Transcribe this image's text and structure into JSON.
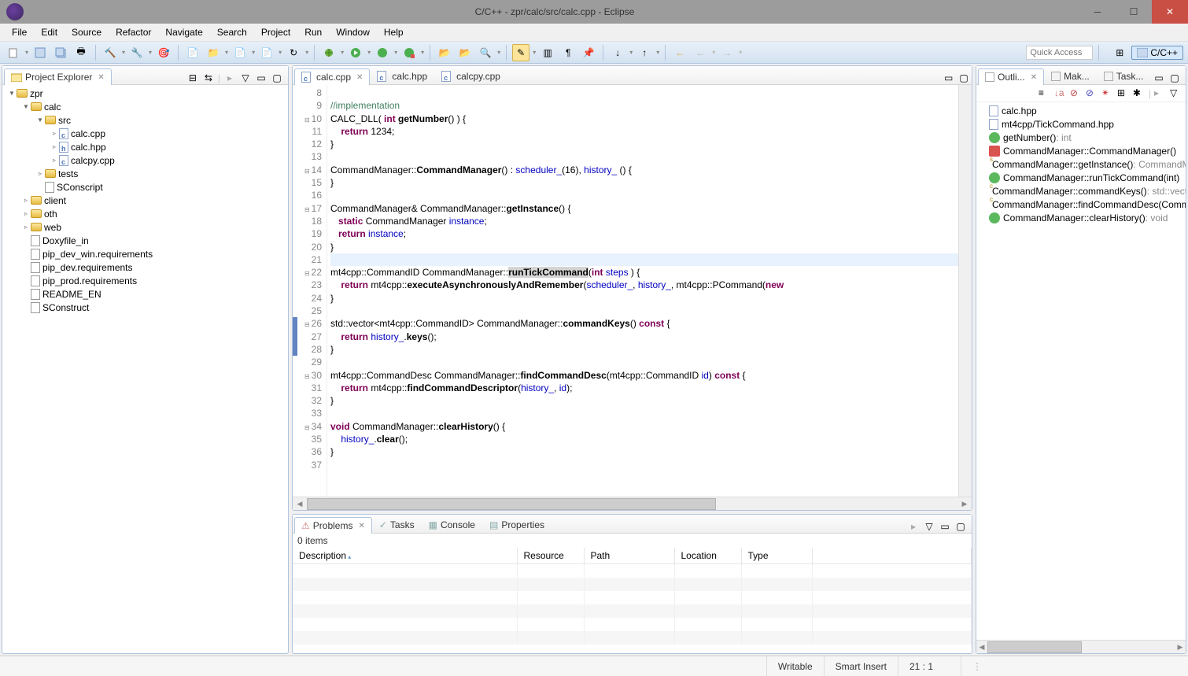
{
  "window": {
    "title": "C/C++ - zpr/calc/src/calc.cpp - Eclipse"
  },
  "menu": [
    "File",
    "Edit",
    "Source",
    "Refactor",
    "Navigate",
    "Search",
    "Project",
    "Run",
    "Window",
    "Help"
  ],
  "quick_access_placeholder": "Quick Access",
  "perspective": {
    "label": "C/C++"
  },
  "project_explorer": {
    "title": "Project Explorer",
    "root": "zpr",
    "tree": [
      {
        "lvl": 0,
        "exp": "▼",
        "icon": "proj",
        "label": "zpr"
      },
      {
        "lvl": 1,
        "exp": "▼",
        "icon": "folder",
        "label": "calc"
      },
      {
        "lvl": 2,
        "exp": "▼",
        "icon": "folder",
        "label": "src"
      },
      {
        "lvl": 3,
        "exp": "▹",
        "icon": "cfile",
        "label": "calc.cpp"
      },
      {
        "lvl": 3,
        "exp": "▹",
        "icon": "hfile",
        "label": "calc.hpp"
      },
      {
        "lvl": 3,
        "exp": "▹",
        "icon": "cfile",
        "label": "calcpy.cpp"
      },
      {
        "lvl": 2,
        "exp": "▹",
        "icon": "folder",
        "label": "tests"
      },
      {
        "lvl": 2,
        "exp": "",
        "icon": "file",
        "label": "SConscript"
      },
      {
        "lvl": 1,
        "exp": "▹",
        "icon": "folder",
        "label": "client"
      },
      {
        "lvl": 1,
        "exp": "▹",
        "icon": "folder",
        "label": "oth"
      },
      {
        "lvl": 1,
        "exp": "▹",
        "icon": "folder",
        "label": "web"
      },
      {
        "lvl": 1,
        "exp": "",
        "icon": "file",
        "label": "Doxyfile_in"
      },
      {
        "lvl": 1,
        "exp": "",
        "icon": "file",
        "label": "pip_dev_win.requirements"
      },
      {
        "lvl": 1,
        "exp": "",
        "icon": "file",
        "label": "pip_dev.requirements"
      },
      {
        "lvl": 1,
        "exp": "",
        "icon": "file",
        "label": "pip_prod.requirements"
      },
      {
        "lvl": 1,
        "exp": "",
        "icon": "file",
        "label": "README_EN"
      },
      {
        "lvl": 1,
        "exp": "",
        "icon": "file",
        "label": "SConstruct"
      }
    ]
  },
  "editor": {
    "tabs": [
      {
        "label": "calc.cpp",
        "active": true
      },
      {
        "label": "calc.hpp",
        "active": false
      },
      {
        "label": "calcpy.cpp",
        "active": false
      }
    ],
    "first_line_no": 8,
    "lines": [
      "",
      "//implementation",
      "CALC_DLL( int getNumber() ) {",
      "    return 1234;",
      "}",
      "",
      "CommandManager::CommandManager() : scheduler_(16), history_ () {",
      "}",
      "",
      "CommandManager& CommandManager::getInstance() {",
      "   static CommandManager instance;",
      "   return instance;",
      "}",
      "",
      "mt4cpp::CommandID CommandManager::runTickCommand(int steps ) {",
      "    return mt4cpp::executeAsynchronouslyAndRemember(scheduler_, history_, mt4cpp::PCommand(new",
      "}",
      "",
      "std::vector<mt4cpp::CommandID> CommandManager::commandKeys() const {",
      "    return history_.keys();",
      "}",
      "",
      "mt4cpp::CommandDesc CommandManager::findCommandDesc(mt4cpp::CommandID id) const {",
      "    return mt4cpp::findCommandDescriptor(history_, id);",
      "}",
      "",
      "void CommandManager::clearHistory() {",
      "    history_.clear();",
      "}",
      ""
    ]
  },
  "outline": {
    "tabs": [
      {
        "label": "Outli...",
        "active": true
      },
      {
        "label": "Mak...",
        "active": false
      },
      {
        "label": "Task...",
        "active": false
      }
    ],
    "items": [
      {
        "icon": "inc",
        "label": "calc.hpp"
      },
      {
        "icon": "inc",
        "label": "mt4cpp/TickCommand.hpp"
      },
      {
        "icon": "green",
        "label": "getNumber()",
        "ret": " : int"
      },
      {
        "icon": "red",
        "label": "CommandManager::CommandManager()"
      },
      {
        "icon": "gs",
        "label": "CommandManager::getInstance()",
        "ret": " : CommandManager &"
      },
      {
        "icon": "green",
        "label": "CommandManager::runTickCommand(int)"
      },
      {
        "icon": "gc",
        "label": "CommandManager::commandKeys()",
        "ret": " : std::vector"
      },
      {
        "icon": "gc",
        "label": "CommandManager::findCommandDesc(CommandID)"
      },
      {
        "icon": "green",
        "label": "CommandManager::clearHistory()",
        "ret": " : void"
      }
    ]
  },
  "problems": {
    "tabs": [
      "Problems",
      "Tasks",
      "Console",
      "Properties"
    ],
    "summary": "0 items",
    "columns": [
      "Description",
      "Resource",
      "Path",
      "Location",
      "Type"
    ]
  },
  "status": {
    "writable": "Writable",
    "insert": "Smart Insert",
    "pos": "21 : 1"
  }
}
